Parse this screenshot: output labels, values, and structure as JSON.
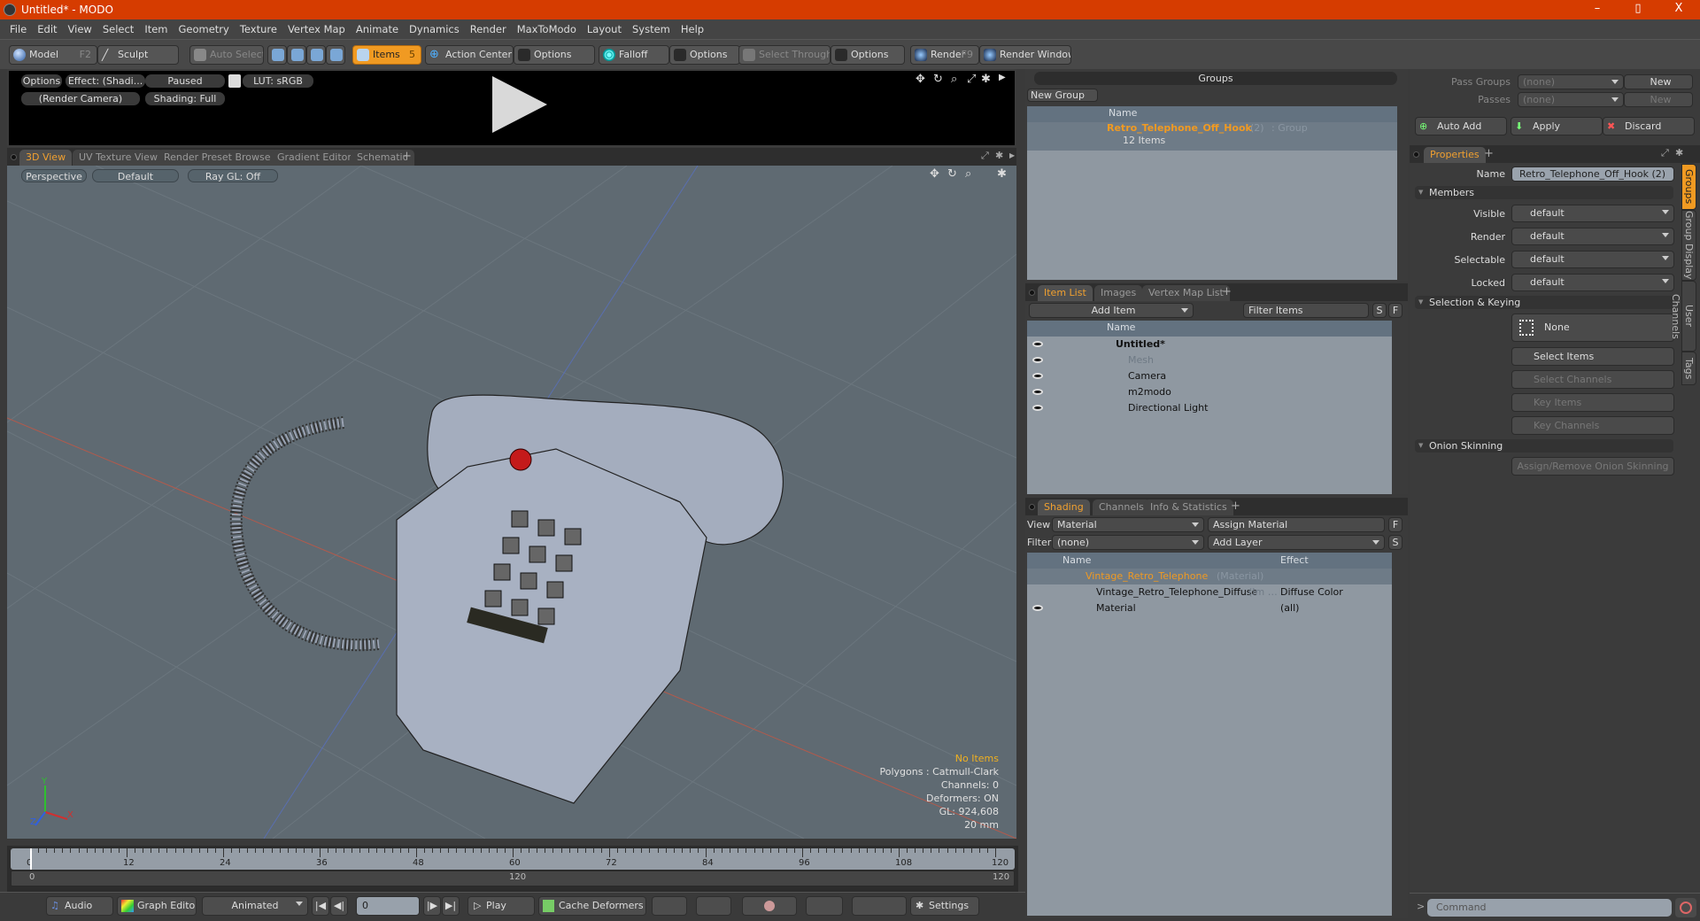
{
  "window": {
    "title": "Untitled* - MODO",
    "controls": [
      "–",
      "▯",
      "X"
    ]
  },
  "menu": [
    "File",
    "Edit",
    "View",
    "Select",
    "Item",
    "Geometry",
    "Texture",
    "Vertex Map",
    "Animate",
    "Dynamics",
    "Render",
    "MaxToModo",
    "Layout",
    "System",
    "Help"
  ],
  "toolbar": {
    "model": "Model",
    "model_key": "F2",
    "sculpt": "Sculpt",
    "auto_select": "Auto Select",
    "items": "Items",
    "items_key": "5",
    "action_center": "Action Center",
    "options1": "Options",
    "falloff": "Falloff",
    "options2": "Options",
    "select_through": "Select Through",
    "options3": "Options",
    "render": "Render",
    "render_key": "F9",
    "render_window": "Render Window"
  },
  "preview": {
    "options": "Options",
    "effect": "Effect: (Shadi...",
    "paused": "Paused",
    "lut": "LUT: sRGB",
    "camera": "(Render Camera)",
    "shading": "Shading: Full"
  },
  "viewport_tabs": [
    {
      "label": "3D View",
      "active": true
    },
    {
      "label": "UV Texture View",
      "active": false
    },
    {
      "label": "Render Preset Browser",
      "active": false
    },
    {
      "label": "Gradient Editor",
      "active": false
    },
    {
      "label": "Schematic",
      "active": false
    }
  ],
  "viewport": {
    "projection": "Perspective",
    "style": "Default",
    "raygl": "Ray GL: Off",
    "stats": {
      "selection": "No Items",
      "polygons": "Polygons : Catmull-Clark",
      "channels": "Channels: 0",
      "deformers": "Deformers: ON",
      "gl": "GL: 924,608",
      "scale": "20 mm"
    },
    "axes": {
      "x": "X",
      "y": "Y",
      "z": "Z"
    }
  },
  "timeline": {
    "ticks": [
      "0",
      "12",
      "24",
      "36",
      "48",
      "60",
      "72",
      "84",
      "96",
      "108",
      "120"
    ],
    "range_start": "0",
    "range_mid": "120",
    "range_end": "120",
    "current_frame": 0
  },
  "bottombar": {
    "audio": "Audio",
    "graph_editor": "Graph Editor",
    "animated": "Animated",
    "frame_value": "0",
    "play": "Play",
    "cache_deformers": "Cache Deformers",
    "settings": "Settings"
  },
  "groups": {
    "title": "Groups",
    "new_group": "New Group",
    "col_name": "Name",
    "rows": [
      {
        "name": "Retro_Telephone_Off_Hook",
        "count": "(2)",
        "type": ": Group",
        "sub": "12 Items"
      }
    ]
  },
  "item_list": {
    "tabs": [
      {
        "label": "Item List",
        "active": true
      },
      {
        "label": "Images",
        "active": false
      },
      {
        "label": "Vertex Map List",
        "active": false
      }
    ],
    "add_item": "Add Item",
    "filter_placeholder": "Filter Items",
    "s": "S",
    "f": "F",
    "col_name": "Name",
    "rows": [
      {
        "name": "Untitled*",
        "bold": true
      },
      {
        "name": "Mesh",
        "dim": true
      },
      {
        "name": "Camera"
      },
      {
        "name": "m2modo"
      },
      {
        "name": "Directional Light"
      }
    ]
  },
  "shading": {
    "tabs": [
      {
        "label": "Shading",
        "active": true
      },
      {
        "label": "Channels",
        "active": false
      },
      {
        "label": "Info & Statistics",
        "active": false
      }
    ],
    "view_label": "View",
    "view_value": "Material",
    "assign_material": "Assign Material",
    "f": "F",
    "filter_label": "Filter",
    "filter_value": "(none)",
    "add_layer": "Add Layer",
    "s": "S",
    "col_name": "Name",
    "col_effect": "Effect",
    "rows": [
      {
        "name": "Vintage_Retro_Telephone",
        "suffix": "(Material)",
        "effect": ""
      },
      {
        "name": "Vintage_Retro_Telephone_Diffuse",
        "suffix": "(Im …",
        "effect": "Diffuse Color"
      },
      {
        "name": "Material",
        "suffix": "",
        "effect": "(all)"
      }
    ]
  },
  "passes": {
    "pass_groups_label": "Pass Groups",
    "pass_groups_value": "(none)",
    "new1": "New",
    "passes_label": "Passes",
    "passes_value": "(none)",
    "new2": "New",
    "auto_add": "Auto Add",
    "apply": "Apply",
    "discard": "Discard"
  },
  "properties": {
    "tab": "Properties",
    "name_label": "Name",
    "name_value": "Retro_Telephone_Off_Hook (2)",
    "members": "Members",
    "fields": [
      {
        "label": "Visible",
        "value": "default"
      },
      {
        "label": "Render",
        "value": "default"
      },
      {
        "label": "Selectable",
        "value": "default"
      },
      {
        "label": "Locked",
        "value": "default"
      }
    ],
    "selection_keying": "Selection & Keying",
    "none": "None",
    "select_items": "Select Items",
    "select_channels": "Select Channels",
    "key_items": "Key Items",
    "key_channels": "Key Channels",
    "onion": "Onion Skinning",
    "onion_btn": "Assign/Remove Onion Skinning",
    "side_tabs": [
      {
        "label": "Groups",
        "active": true
      },
      {
        "label": "Group Display",
        "active": false
      },
      {
        "label": "User Channels",
        "active": false
      },
      {
        "label": "Tags",
        "active": false
      }
    ]
  },
  "command": {
    "prompt": ">",
    "placeholder": "Command"
  }
}
